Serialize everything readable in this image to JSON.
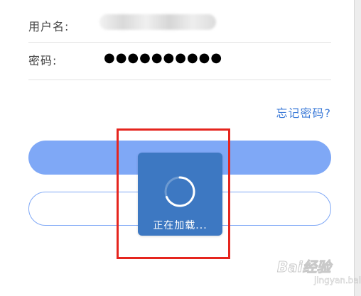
{
  "form": {
    "username_label": "用户名:",
    "password_label": "密码:",
    "password_value": "●●●●●●●●●●",
    "forgot_password": "忘记密码?"
  },
  "buttons": {
    "login_label": "",
    "register_label": ""
  },
  "loading": {
    "text": "正在加载..."
  },
  "watermark": {
    "text": "Bai经验",
    "sub": "jingyan.baidu.com"
  },
  "colors": {
    "accent": "#7fa8f6",
    "link": "#3d7bd8",
    "toast": "#3d78c2",
    "highlight": "#e5251e"
  }
}
